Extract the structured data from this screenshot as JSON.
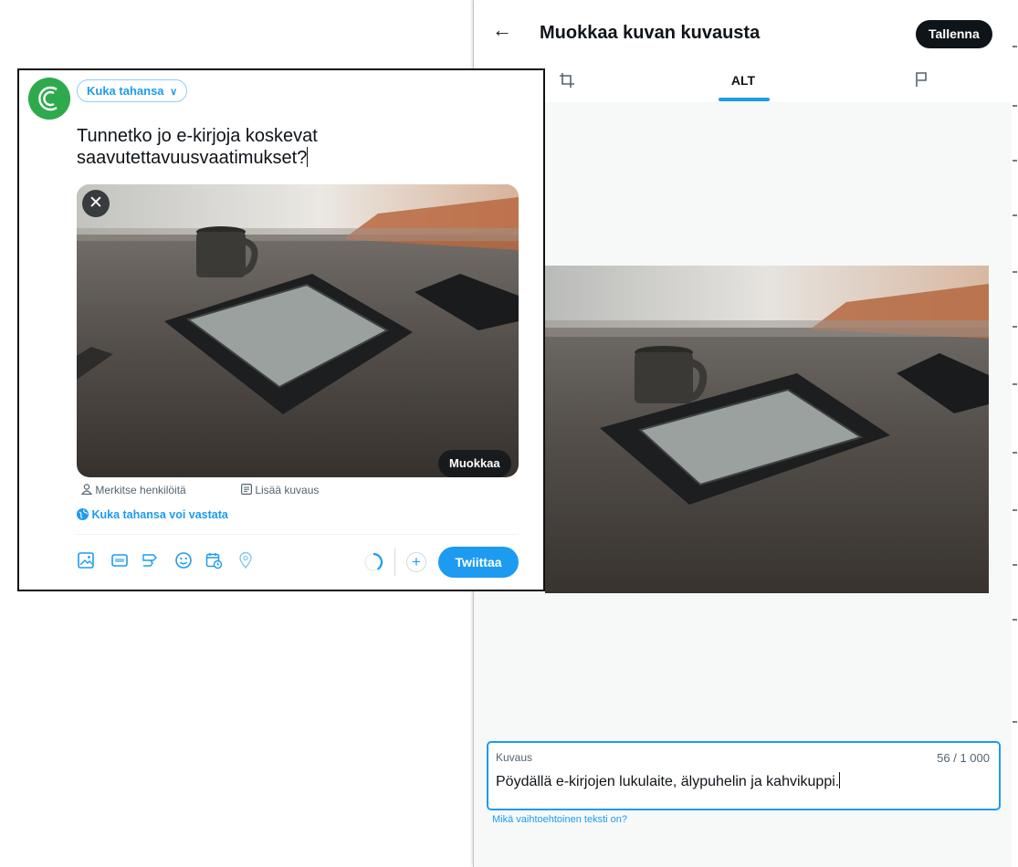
{
  "modal": {
    "title": "Muokkaa kuvan kuvausta",
    "save_label": "Tallenna",
    "tabs": {
      "alt_label": "ALT"
    },
    "description": {
      "label": "Kuvaus",
      "count": "56 / 1 000",
      "value": "Pöydällä e-kirjojen lukulaite, älypuhelin ja kahvikuppi."
    },
    "help_link": "Mikä vaihtoehtoinen teksti on?"
  },
  "composer": {
    "audience_label": "Kuka tahansa",
    "text_line1": "Tunnetko jo e-kirjoja koskevat",
    "text_line2": "saavutettavuusvaatimukset?",
    "edit_media_label": "Muokkaa",
    "tag_people_label": "Merkitse henkilöitä",
    "add_description_label": "Lisää kuvaus",
    "reply_setting_label": "Kuka tahansa voi vastata",
    "tweet_label": "Twiittaa"
  },
  "icons": {
    "back": "arrow-left-icon",
    "crop": "crop-icon",
    "flag": "flag-icon",
    "remove": "close-icon",
    "person": "person-icon",
    "description": "list-icon",
    "globe": "globe-icon",
    "tools": [
      "image-icon",
      "gif-icon",
      "poll-icon",
      "emoji-icon",
      "schedule-icon",
      "location-icon"
    ],
    "add": "plus-icon"
  },
  "colors": {
    "accent": "#1d9bf0",
    "dark_button": "#0f1419",
    "avatar_green": "#2eaa4c",
    "muted_text": "#536471"
  }
}
